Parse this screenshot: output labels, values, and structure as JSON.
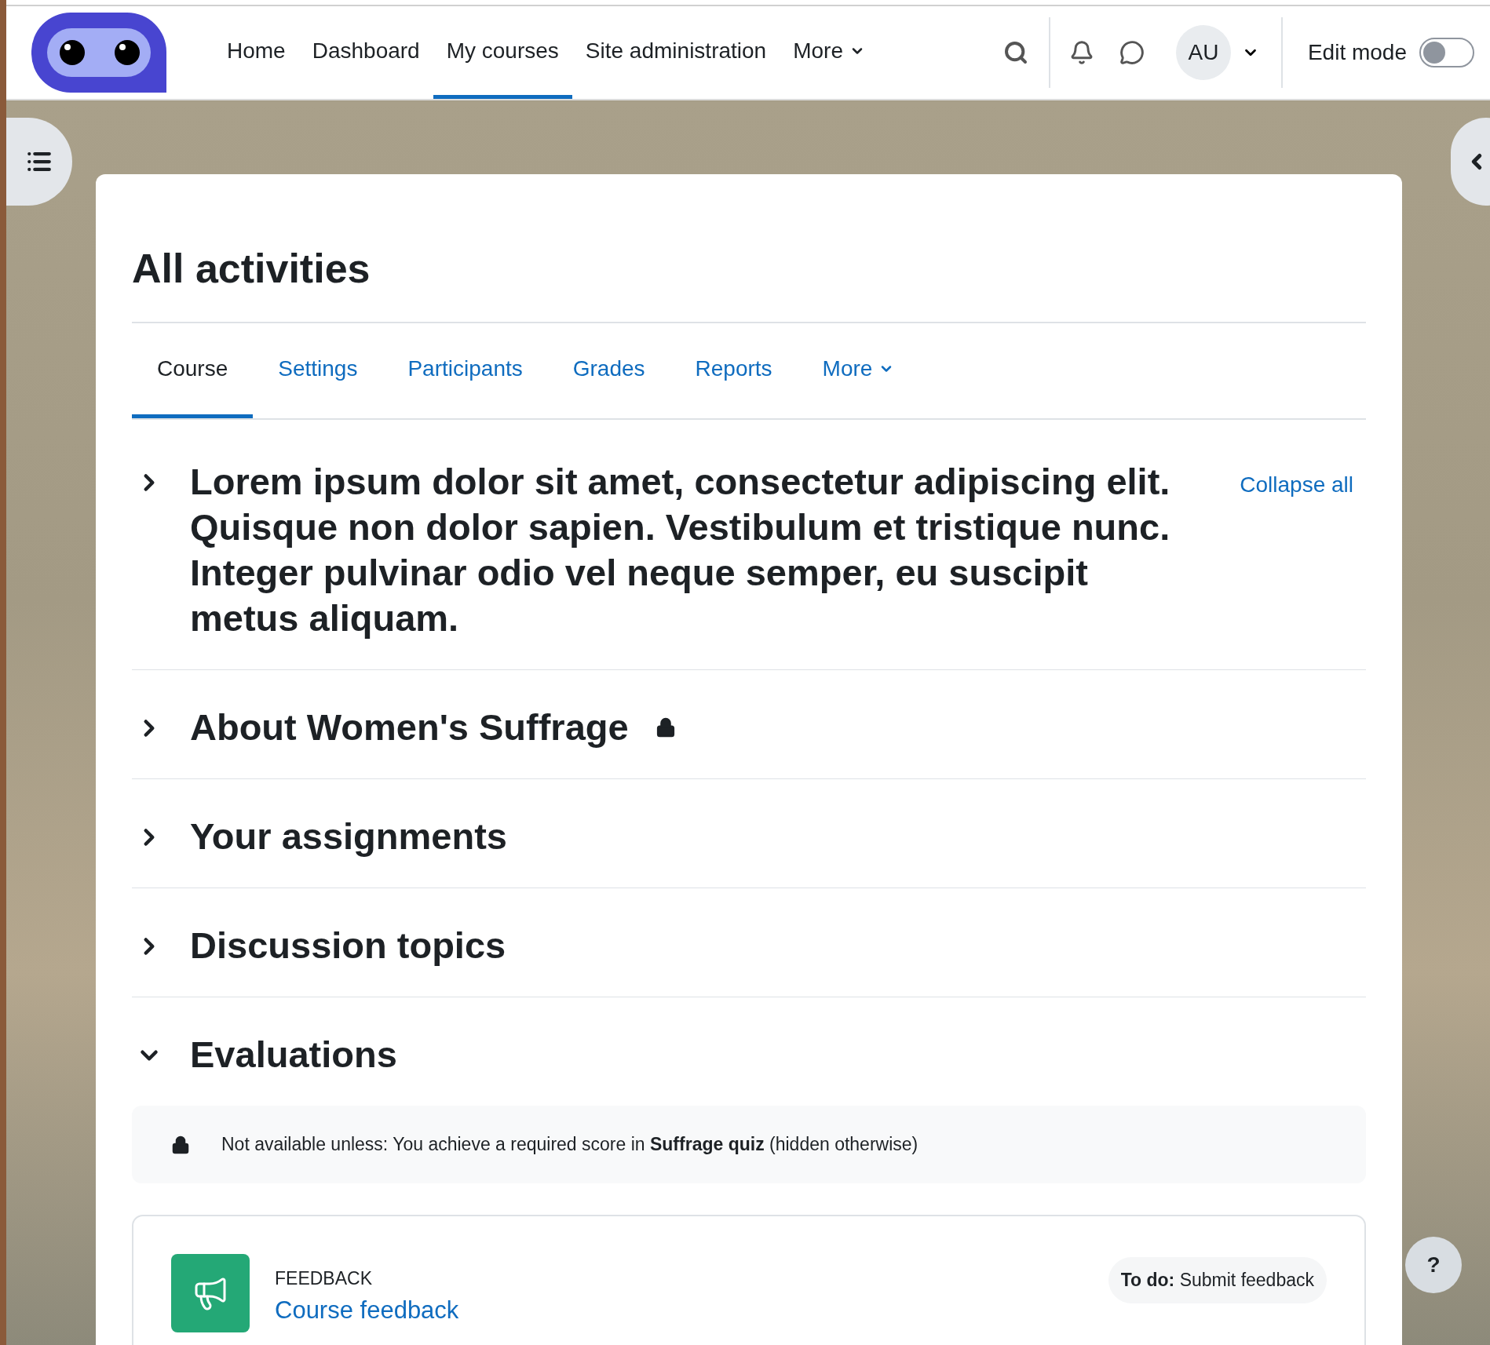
{
  "navbar": {
    "items": [
      {
        "label": "Home",
        "selected": false
      },
      {
        "label": "Dashboard",
        "selected": false
      },
      {
        "label": "My courses",
        "selected": true
      },
      {
        "label": "Site administration",
        "selected": false
      }
    ],
    "more": "More",
    "avatar": "AU",
    "edit_mode": {
      "label": "Edit mode",
      "on": false
    }
  },
  "page": {
    "title": "All activities",
    "tabs": [
      {
        "label": "Course",
        "selected": true
      },
      {
        "label": "Settings",
        "selected": false
      },
      {
        "label": "Participants",
        "selected": false
      },
      {
        "label": "Grades",
        "selected": false
      },
      {
        "label": "Reports",
        "selected": false
      }
    ],
    "tabs_more": "More",
    "collapse_all": "Collapse all",
    "sections": [
      {
        "title": "Lorem ipsum dolor sit amet, consectetur adipiscing elit. Quisque non dolor sapien. Vestibulum et tristique nunc. Integer pulvinar odio vel neque semper, eu suscipit metus aliquam.",
        "expanded": false,
        "locked": false
      },
      {
        "title": "About Women's Suffrage",
        "expanded": false,
        "locked": true
      },
      {
        "title": "Your assignments",
        "expanded": false,
        "locked": false
      },
      {
        "title": "Discussion topics",
        "expanded": false,
        "locked": false
      },
      {
        "title": "Evaluations",
        "expanded": true,
        "locked": false,
        "restriction": "Not available unless: You achieve a required score in **Suffrage quiz** (hidden otherwise)",
        "activities": [
          {
            "type": "FEEDBACK",
            "name": "Course feedback",
            "todo": "**To do:** Submit feedback"
          }
        ]
      }
    ]
  },
  "help": "?"
}
